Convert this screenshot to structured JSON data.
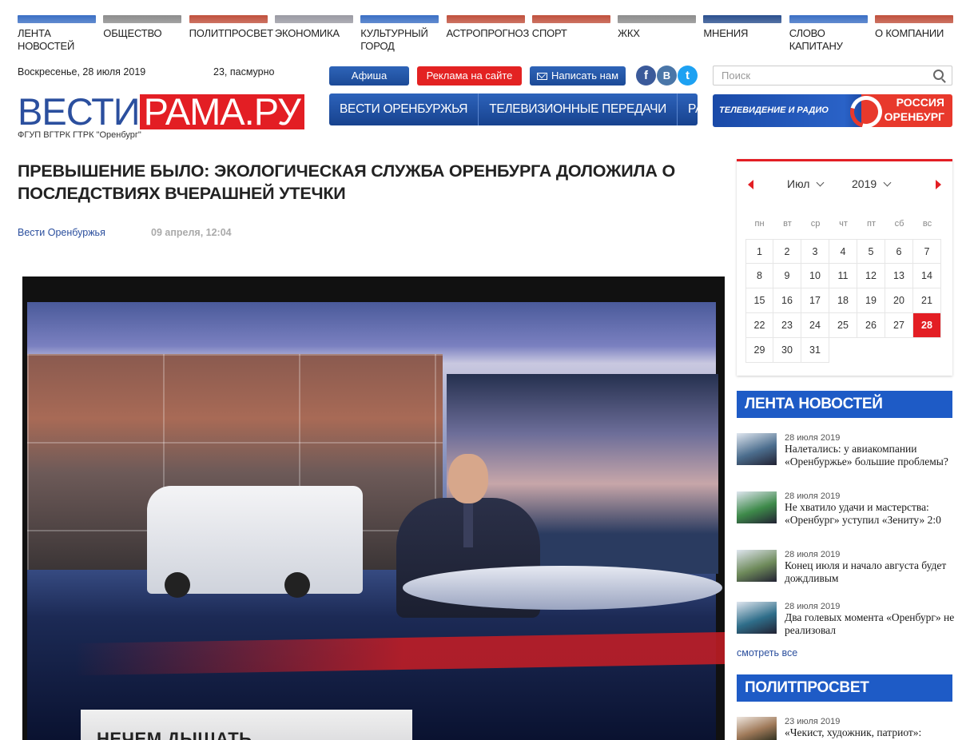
{
  "topnav": [
    {
      "label": "ЛЕНТА НОВОСТЕЙ",
      "color": "#3a6fc4"
    },
    {
      "label": "ОБЩЕСТВО",
      "color": "#8c8c8c"
    },
    {
      "label": "ПОЛИТПРОСВЕТ",
      "color": "#c0503c"
    },
    {
      "label": "ЭКОНОМИКА",
      "color": "#9a9aa3"
    },
    {
      "label": "КУЛЬТУРНЫЙ ГОРОД",
      "color": "#3a6fc4"
    },
    {
      "label": "АСТРОПРОГНОЗ",
      "color": "#c0503c"
    },
    {
      "label": "СПОРТ",
      "color": "#c0503c"
    },
    {
      "label": "ЖКХ",
      "color": "#8c8c8c"
    },
    {
      "label": "МНЕНИЯ",
      "color": "#2a4f8e"
    },
    {
      "label": "СЛОВО КАПИТАНУ",
      "color": "#3a6fc4"
    },
    {
      "label": "О КОМПАНИИ",
      "color": "#c0503c"
    }
  ],
  "header": {
    "date": "Воскресенье, 28 июля 2019",
    "weather": "23, пасмурно",
    "btn_afisha": "Афиша",
    "btn_ads": "Реклама на сайте",
    "btn_write": "Написать нам",
    "social": {
      "fb": "f",
      "vk": "B",
      "tw": "t"
    },
    "search_placeholder": "Поиск"
  },
  "logo": {
    "part1": "ВЕСТИ",
    "part2": "РАМА.РУ",
    "sub": "ФГУП ВГТРК ГТРК \"Оренбург\""
  },
  "mainnav": [
    "ВЕСТИ ОРЕНБУРЖЬЯ",
    "ТЕЛЕВИЗИОННЫЕ ПЕРЕДАЧИ",
    "РАДИО"
  ],
  "rossia": {
    "tagline": "ТЕЛЕВИДЕНИЕ И РАДИО",
    "line1": "РОССИЯ",
    "line2": "ОРЕНБУРГ"
  },
  "article": {
    "title": "ПРЕВЫШЕНИЕ БЫЛО: ЭКОЛОГИЧЕСКАЯ СЛУЖБА ОРЕНБУРГА ДОЛОЖИЛА О ПОСЛЕДСТВИЯХ ВЧЕРАШНЕЙ УТЕЧКИ",
    "author": "Вести Оренбуржья",
    "date": "09 апреля, 12:04",
    "video_caption": "НЕЧЕМ ДЫШАТЬ"
  },
  "calendar": {
    "month": "Июл",
    "year": "2019",
    "weekdays": [
      "пн",
      "вт",
      "ср",
      "чт",
      "пт",
      "сб",
      "вс"
    ],
    "days": [
      "1",
      "2",
      "3",
      "4",
      "5",
      "6",
      "7",
      "8",
      "9",
      "10",
      "11",
      "12",
      "13",
      "14",
      "15",
      "16",
      "17",
      "18",
      "19",
      "20",
      "21",
      "22",
      "23",
      "24",
      "25",
      "26",
      "27",
      "28",
      "29",
      "30",
      "31"
    ],
    "today": "28"
  },
  "feed": {
    "title": "ЛЕНТА НОВОСТЕЙ",
    "items": [
      {
        "date": "28 июля 2019",
        "text": "Налетались: у авиакомпании «Оренбуржье» большие проблемы?",
        "thumb": "#4c6e8e"
      },
      {
        "date": "28 июля 2019",
        "text": "Не хватило удачи и мастерства: «Оренбург» уступил «Зениту» 2:0",
        "thumb": "#3e8a4a"
      },
      {
        "date": "28 июля 2019",
        "text": "Конец июля и начало августа будет дождливым",
        "thumb": "#6e8a5a"
      },
      {
        "date": "28 июля 2019",
        "text": "Два голевых момента «Оренбург» не реализовал",
        "thumb": "#2f6e8a"
      }
    ],
    "more": "смотреть все"
  },
  "politprosvet": {
    "title": "ПОЛИТПРОСВЕТ",
    "items": [
      {
        "date": "23 июля 2019",
        "text": "«Чекист, художник, патриот»:",
        "thumb": "#a07a5a"
      }
    ]
  }
}
